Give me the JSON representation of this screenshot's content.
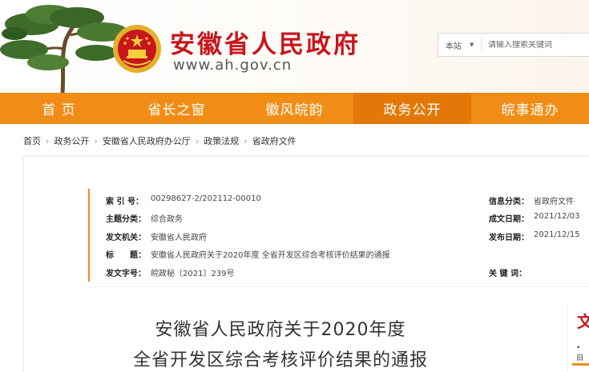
{
  "header": {
    "site_title": "安徽省人民政府",
    "site_url": "www.ah.gov.cn",
    "search_scope": "本站",
    "search_placeholder": "请输入搜索关键词"
  },
  "nav": {
    "items": [
      {
        "label": "首 页"
      },
      {
        "label": "省长之窗"
      },
      {
        "label": "徽风皖韵"
      },
      {
        "label": "政务公开"
      },
      {
        "label": "皖事通办"
      }
    ],
    "active_index": 3
  },
  "breadcrumb": [
    "首页",
    "政务公开",
    "安徽省人民政府办公厅",
    "政策法规",
    "省政府文件"
  ],
  "meta": {
    "index_label": "索 引 号：",
    "index_value": "00298627-2/202112-00010",
    "topic_label": "主题分类：",
    "topic_value": "综合政务",
    "issuer_label": "发文机关：",
    "issuer_value": "安徽省人民政府",
    "title_label": "标　　题：",
    "title_value": "安徽省人民政府关于2020年度 全省开发区综合考核评价结果的通报",
    "docno_label": "发文字号：",
    "docno_value": "皖政秘〔2021〕239号",
    "info_label": "信息分类：",
    "info_value": "省政府文件",
    "created_label": "成文日期：",
    "created_value": "2021/12/03",
    "published_label": "发布日期：",
    "published_value": "2021/12/15",
    "keywords_label": "关 键 词："
  },
  "document": {
    "title_line1": "安徽省人民政府关于2020年度",
    "title_line2": "全省开发区综合考核评价结果的通报"
  },
  "side": {
    "heading_char": "文",
    "bullet": "• 旧"
  },
  "colors": {
    "brand_red": "#c8161d",
    "nav_orange": "#f18d16",
    "nav_active": "#e37809"
  }
}
